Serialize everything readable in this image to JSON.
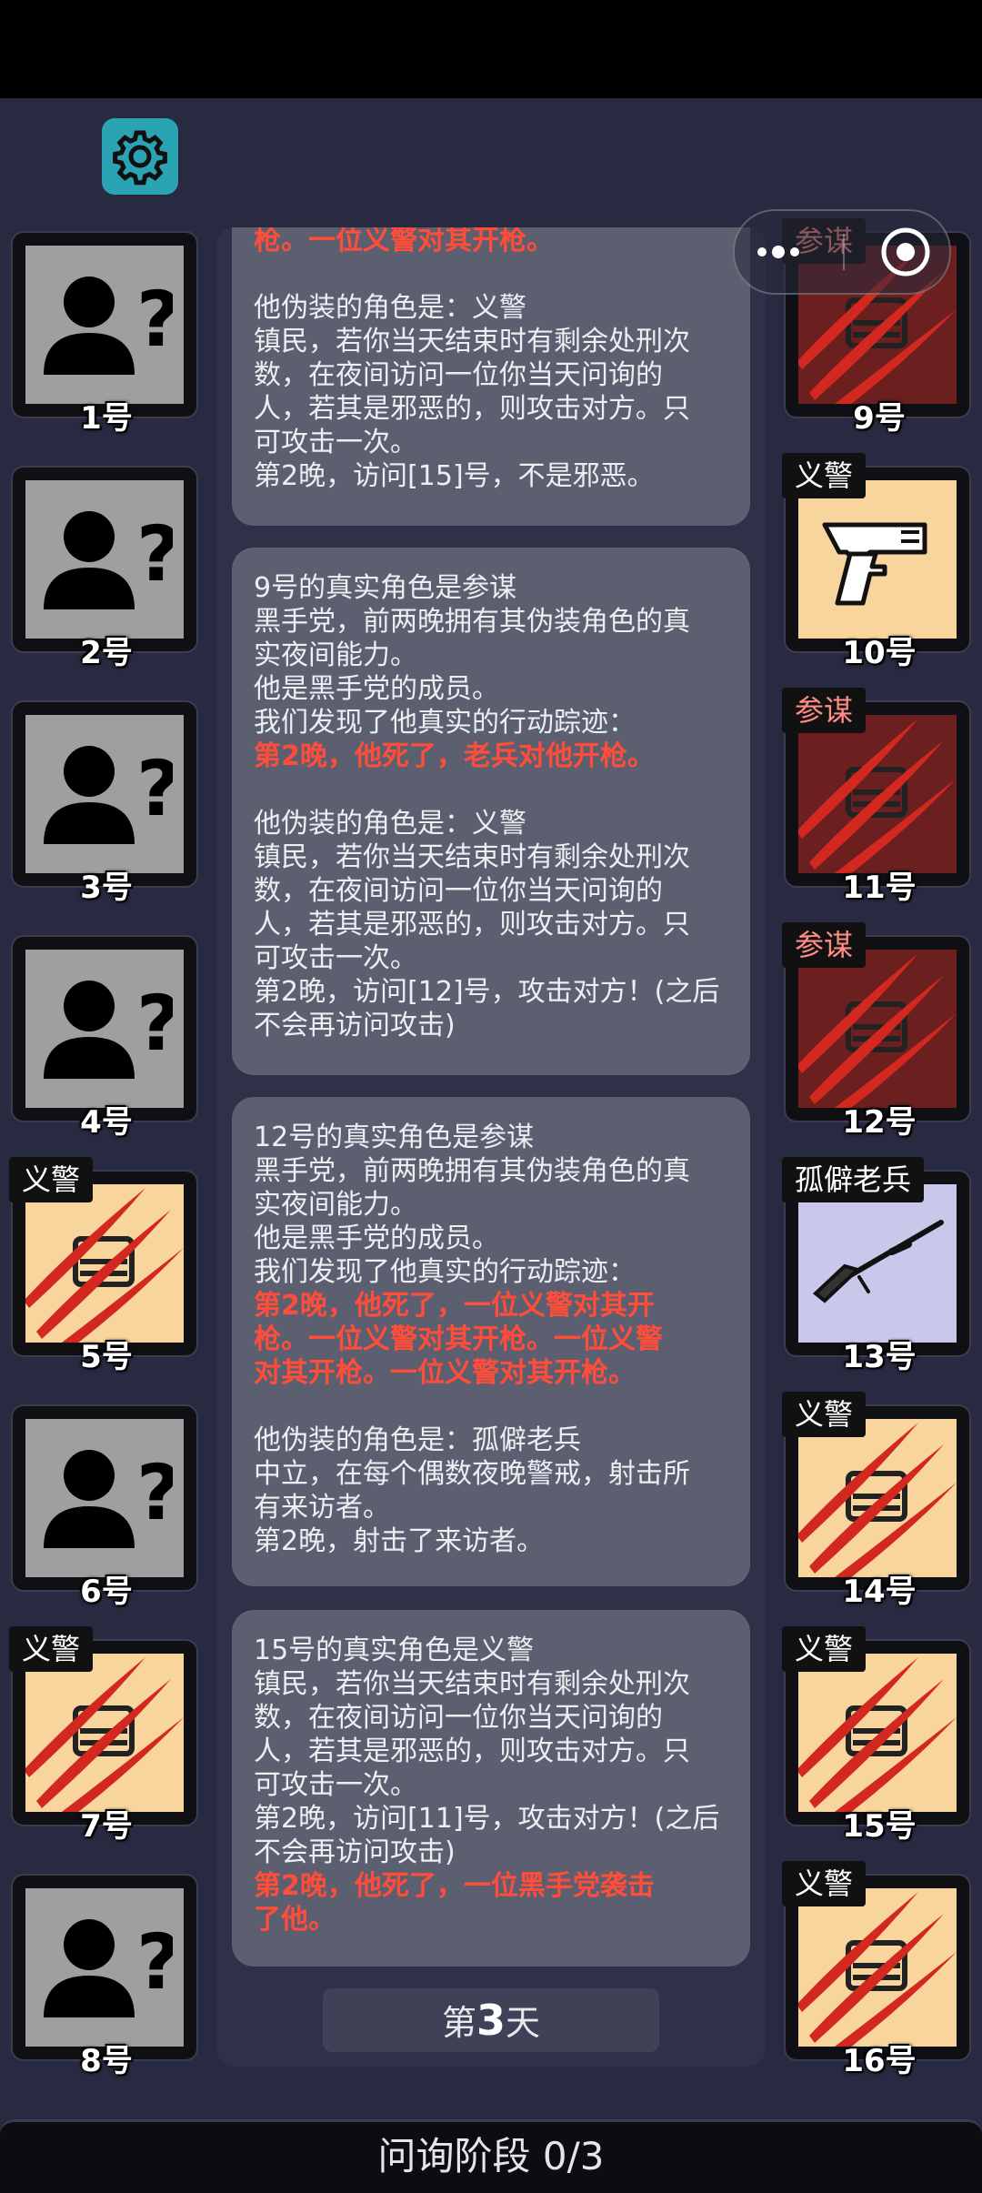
{
  "phase_label": "问询阶段 0/3",
  "day": {
    "prefix": "第",
    "number": "3",
    "suffix": "天"
  },
  "left_players": [
    {
      "num": "1号",
      "role": "",
      "face": "unknown"
    },
    {
      "num": "2号",
      "role": "",
      "face": "unknown"
    },
    {
      "num": "3号",
      "role": "",
      "face": "unknown"
    },
    {
      "num": "4号",
      "role": "",
      "face": "unknown"
    },
    {
      "num": "5号",
      "role": "义警",
      "face": "cream-slash"
    },
    {
      "num": "6号",
      "role": "",
      "face": "unknown"
    },
    {
      "num": "7号",
      "role": "义警",
      "face": "cream-slash"
    },
    {
      "num": "8号",
      "role": "",
      "face": "unknown"
    }
  ],
  "right_players": [
    {
      "num": "9号",
      "role": "参谋",
      "face": "red-slash"
    },
    {
      "num": "10号",
      "role": "义警",
      "face": "cream-gun"
    },
    {
      "num": "11号",
      "role": "参谋",
      "face": "red-slash"
    },
    {
      "num": "12号",
      "role": "参谋",
      "face": "red-slash"
    },
    {
      "num": "13号",
      "role": "孤僻老兵",
      "face": "lav-rifle"
    },
    {
      "num": "14号",
      "role": "义警",
      "face": "cream-slash"
    },
    {
      "num": "15号",
      "role": "义警",
      "face": "cream-slash"
    },
    {
      "num": "16号",
      "role": "义警",
      "face": "cream-slash"
    }
  ],
  "messages": [
    {
      "top_hl": "枪。一位义警对其开枪。",
      "lines": [
        "他伪装的角色是：义警",
        "镇民，若你当天结束时有剩余处刑次",
        "数，在夜间访问一位你当天问询的",
        "人，若其是邪恶的，则攻击对方。只",
        "可攻击一次。",
        "第2晚，访问[15]号，不是邪恶。"
      ]
    },
    {
      "lines_a": [
        "9号的真实角色是参谋",
        "黑手党，前两晚拥有其伪装角色的真",
        "实夜间能力。",
        "他是黑手党的成员。",
        "我们发现了他真实的行动踪迹："
      ],
      "hl": "第2晚，他死了，老兵对他开枪。",
      "lines_b": [
        "他伪装的角色是：义警",
        "镇民，若你当天结束时有剩余处刑次",
        "数，在夜间访问一位你当天问询的",
        "人，若其是邪恶的，则攻击对方。只",
        "可攻击一次。",
        "第2晚，访问[12]号，攻击对方！(之后",
        "不会再访问攻击)"
      ]
    },
    {
      "lines_a": [
        "12号的真实角色是参谋",
        "黑手党，前两晚拥有其伪装角色的真",
        "实夜间能力。",
        "他是黑手党的成员。",
        "我们发现了他真实的行动踪迹："
      ],
      "hl": [
        "第2晚，他死了，一位义警对其开",
        "枪。一位义警对其开枪。一位义警",
        "对其开枪。一位义警对其开枪。"
      ],
      "lines_b": [
        "他伪装的角色是：孤僻老兵",
        "中立，在每个偶数夜晚警戒，射击所",
        "有来访者。",
        "第2晚，射击了来访者。"
      ]
    },
    {
      "lines_a": [
        "15号的真实角色是义警",
        "镇民，若你当天结束时有剩余处刑次",
        "数，在夜间访问一位你当天问询的",
        "人，若其是邪恶的，则攻击对方。只",
        "可攻击一次。",
        "第2晚，访问[11]号，攻击对方！(之后",
        "不会再访问攻击)"
      ],
      "hl": [
        "第2晚，他死了，一位黑手党袭击",
        "了他。"
      ]
    }
  ]
}
